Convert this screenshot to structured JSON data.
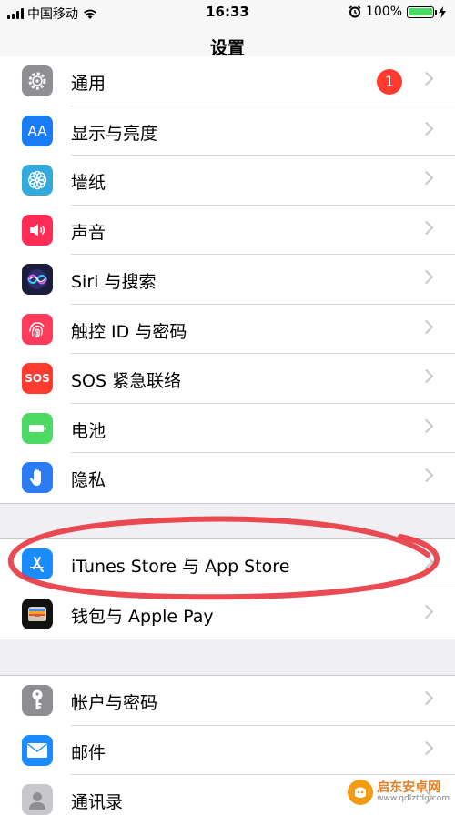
{
  "status": {
    "carrier": "中国移动",
    "time": "16:33",
    "battery_text": "100%",
    "battery_level": 1.0
  },
  "nav": {
    "title": "设置"
  },
  "colors": {
    "general_icon": "#8e8e93",
    "display_icon": "#1a7cf5",
    "wallpaper_icon": "#34aadc",
    "sounds_icon": "#ff2d55",
    "siri_icon": "#1c1c3c",
    "touchid_icon": "#ff3b5c",
    "sos_icon": "#ff3b30",
    "battery_icon": "#4cd964",
    "privacy_icon": "#2b7bf5",
    "appstore_icon": "#1a8cff",
    "wallet_icon": "#111111",
    "passwords_icon": "#8e8e93",
    "mail_icon": "#1a8cff",
    "contacts_icon": "#c7c7cc",
    "annotation": "#e8363f"
  },
  "group1": [
    {
      "label": "通用",
      "icon": "gear-icon",
      "badge": "1"
    },
    {
      "label": "显示与亮度",
      "icon": "display-brightness-icon",
      "icon_text": "AA"
    },
    {
      "label": "墙纸",
      "icon": "flower-icon"
    },
    {
      "label": "声音",
      "icon": "speaker-icon"
    },
    {
      "label": "Siri 与搜索",
      "icon": "siri-icon"
    },
    {
      "label": "触控 ID 与密码",
      "icon": "fingerprint-icon"
    },
    {
      "label": "SOS 紧急联络",
      "icon": "sos-icon",
      "icon_text": "SOS"
    },
    {
      "label": "电池",
      "icon": "battery-icon"
    },
    {
      "label": "隐私",
      "icon": "hand-icon"
    }
  ],
  "group2": [
    {
      "label": "iTunes Store 与 App Store",
      "icon": "app-store-icon"
    },
    {
      "label": "钱包与 Apple Pay",
      "icon": "wallet-icon"
    }
  ],
  "group3": [
    {
      "label": "帐户与密码",
      "icon": "key-icon"
    },
    {
      "label": "邮件",
      "icon": "mail-icon"
    },
    {
      "label": "通讯录",
      "icon": "contacts-icon"
    }
  ],
  "watermark": {
    "title": "启东安卓网",
    "url": "www.qdlztdq.com"
  }
}
